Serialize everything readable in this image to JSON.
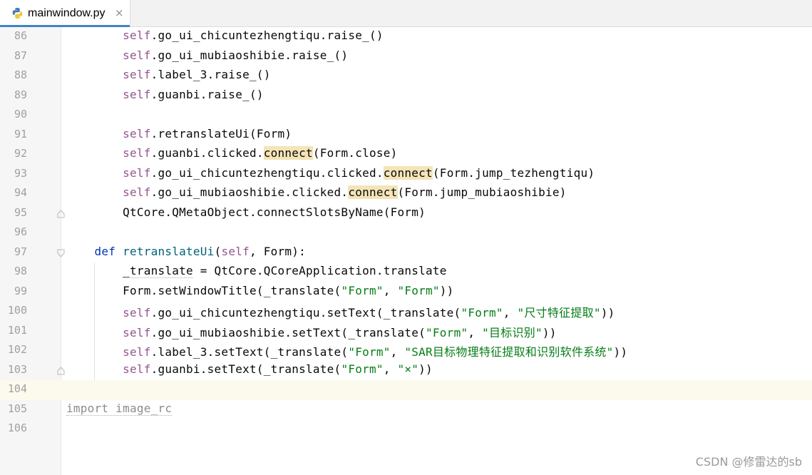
{
  "tab": {
    "filename": "mainwindow.py",
    "close_symbol": "×",
    "icon": "python-file-icon"
  },
  "colors": {
    "self": "#94558d",
    "keyword": "#0033b3",
    "function": "#00627a",
    "string": "#067d17",
    "highlight": "#f4e4b7",
    "current_line": "#fcfaed"
  },
  "editor": {
    "current_line": "104",
    "lines": [
      {
        "num": "86",
        "tokens": [
          [
            "        ",
            ""
          ],
          [
            "self",
            "self"
          ],
          [
            ".go_ui_chicuntezhengtiqu.raise_()",
            ""
          ]
        ]
      },
      {
        "num": "87",
        "tokens": [
          [
            "        ",
            ""
          ],
          [
            "self",
            "self"
          ],
          [
            ".go_ui_mubiaoshibie.raise_()",
            ""
          ]
        ]
      },
      {
        "num": "88",
        "tokens": [
          [
            "        ",
            ""
          ],
          [
            "self",
            "self"
          ],
          [
            ".label_3.raise_()",
            ""
          ]
        ]
      },
      {
        "num": "89",
        "tokens": [
          [
            "        ",
            ""
          ],
          [
            "self",
            "self"
          ],
          [
            ".guanbi.raise_()",
            ""
          ]
        ]
      },
      {
        "num": "90",
        "tokens": []
      },
      {
        "num": "91",
        "tokens": [
          [
            "        ",
            ""
          ],
          [
            "self",
            "self"
          ],
          [
            ".retranslateUi(Form)",
            ""
          ]
        ]
      },
      {
        "num": "92",
        "tokens": [
          [
            "        ",
            ""
          ],
          [
            "self",
            "self"
          ],
          [
            ".guanbi.clicked.",
            ""
          ],
          [
            "connect",
            "hl"
          ],
          [
            "(Form.close)",
            ""
          ]
        ]
      },
      {
        "num": "93",
        "tokens": [
          [
            "        ",
            ""
          ],
          [
            "self",
            "self"
          ],
          [
            ".go_ui_chicuntezhengtiqu.clicked.",
            ""
          ],
          [
            "connect",
            "hl"
          ],
          [
            "(Form.jump_tezhengtiqu)",
            ""
          ]
        ]
      },
      {
        "num": "94",
        "tokens": [
          [
            "        ",
            ""
          ],
          [
            "self",
            "self"
          ],
          [
            ".go_ui_mubiaoshibie.clicked.",
            ""
          ],
          [
            "connect",
            "hl"
          ],
          [
            "(Form.jump_mubiaoshibie)",
            ""
          ]
        ]
      },
      {
        "num": "95",
        "tokens": [
          [
            "        QtCore.QMetaObject.connectSlotsByName(Form)",
            ""
          ]
        ],
        "fold": "end"
      },
      {
        "num": "96",
        "tokens": []
      },
      {
        "num": "97",
        "tokens": [
          [
            "    ",
            ""
          ],
          [
            "def",
            "kw"
          ],
          [
            " ",
            ""
          ],
          [
            "retranslateUi",
            "fn"
          ],
          [
            "(",
            ""
          ],
          [
            "self",
            "self"
          ],
          [
            ", Form):",
            ""
          ]
        ],
        "fold": "start"
      },
      {
        "num": "98",
        "tokens": [
          [
            "        ",
            ""
          ],
          [
            "_translate",
            "ul"
          ],
          [
            " = QtCore.QCoreApplication.translate",
            ""
          ]
        ]
      },
      {
        "num": "99",
        "tokens": [
          [
            "        Form.setWindowTitle(_translate(",
            ""
          ],
          [
            "\"Form\"",
            "str"
          ],
          [
            ", ",
            ""
          ],
          [
            "\"Form\"",
            "str"
          ],
          [
            "))",
            ""
          ]
        ]
      },
      {
        "num": "100",
        "tokens": [
          [
            "        ",
            ""
          ],
          [
            "self",
            "self"
          ],
          [
            ".go_ui_chicuntezhengtiqu.setText(_translate(",
            ""
          ],
          [
            "\"Form\"",
            "str"
          ],
          [
            ", ",
            ""
          ],
          [
            "\"尺寸特征提取\"",
            "str"
          ],
          [
            "))",
            ""
          ]
        ]
      },
      {
        "num": "101",
        "tokens": [
          [
            "        ",
            ""
          ],
          [
            "self",
            "self"
          ],
          [
            ".go_ui_mubiaoshibie.setText(_translate(",
            ""
          ],
          [
            "\"Form\"",
            "str"
          ],
          [
            ", ",
            ""
          ],
          [
            "\"目标识别\"",
            "str"
          ],
          [
            "))",
            ""
          ]
        ]
      },
      {
        "num": "102",
        "tokens": [
          [
            "        ",
            ""
          ],
          [
            "self",
            "self"
          ],
          [
            ".label_3.setText(_translate(",
            ""
          ],
          [
            "\"Form\"",
            "str"
          ],
          [
            ", ",
            ""
          ],
          [
            "\"SAR目标物理特征提取和识别软件系统\"",
            "str"
          ],
          [
            "))",
            ""
          ]
        ]
      },
      {
        "num": "103",
        "tokens": [
          [
            "        ",
            ""
          ],
          [
            "self",
            "self"
          ],
          [
            ".guanbi.setText(_translate(",
            ""
          ],
          [
            "\"Form\"",
            "str"
          ],
          [
            ", ",
            ""
          ],
          [
            "\"×\"",
            "str"
          ],
          [
            "))",
            ""
          ]
        ],
        "fold": "end"
      },
      {
        "num": "104",
        "tokens": []
      },
      {
        "num": "105",
        "tokens": [
          [
            "import image_rc",
            "unused"
          ]
        ]
      },
      {
        "num": "106",
        "tokens": []
      }
    ]
  },
  "watermark": "CSDN @修雷达的sb"
}
